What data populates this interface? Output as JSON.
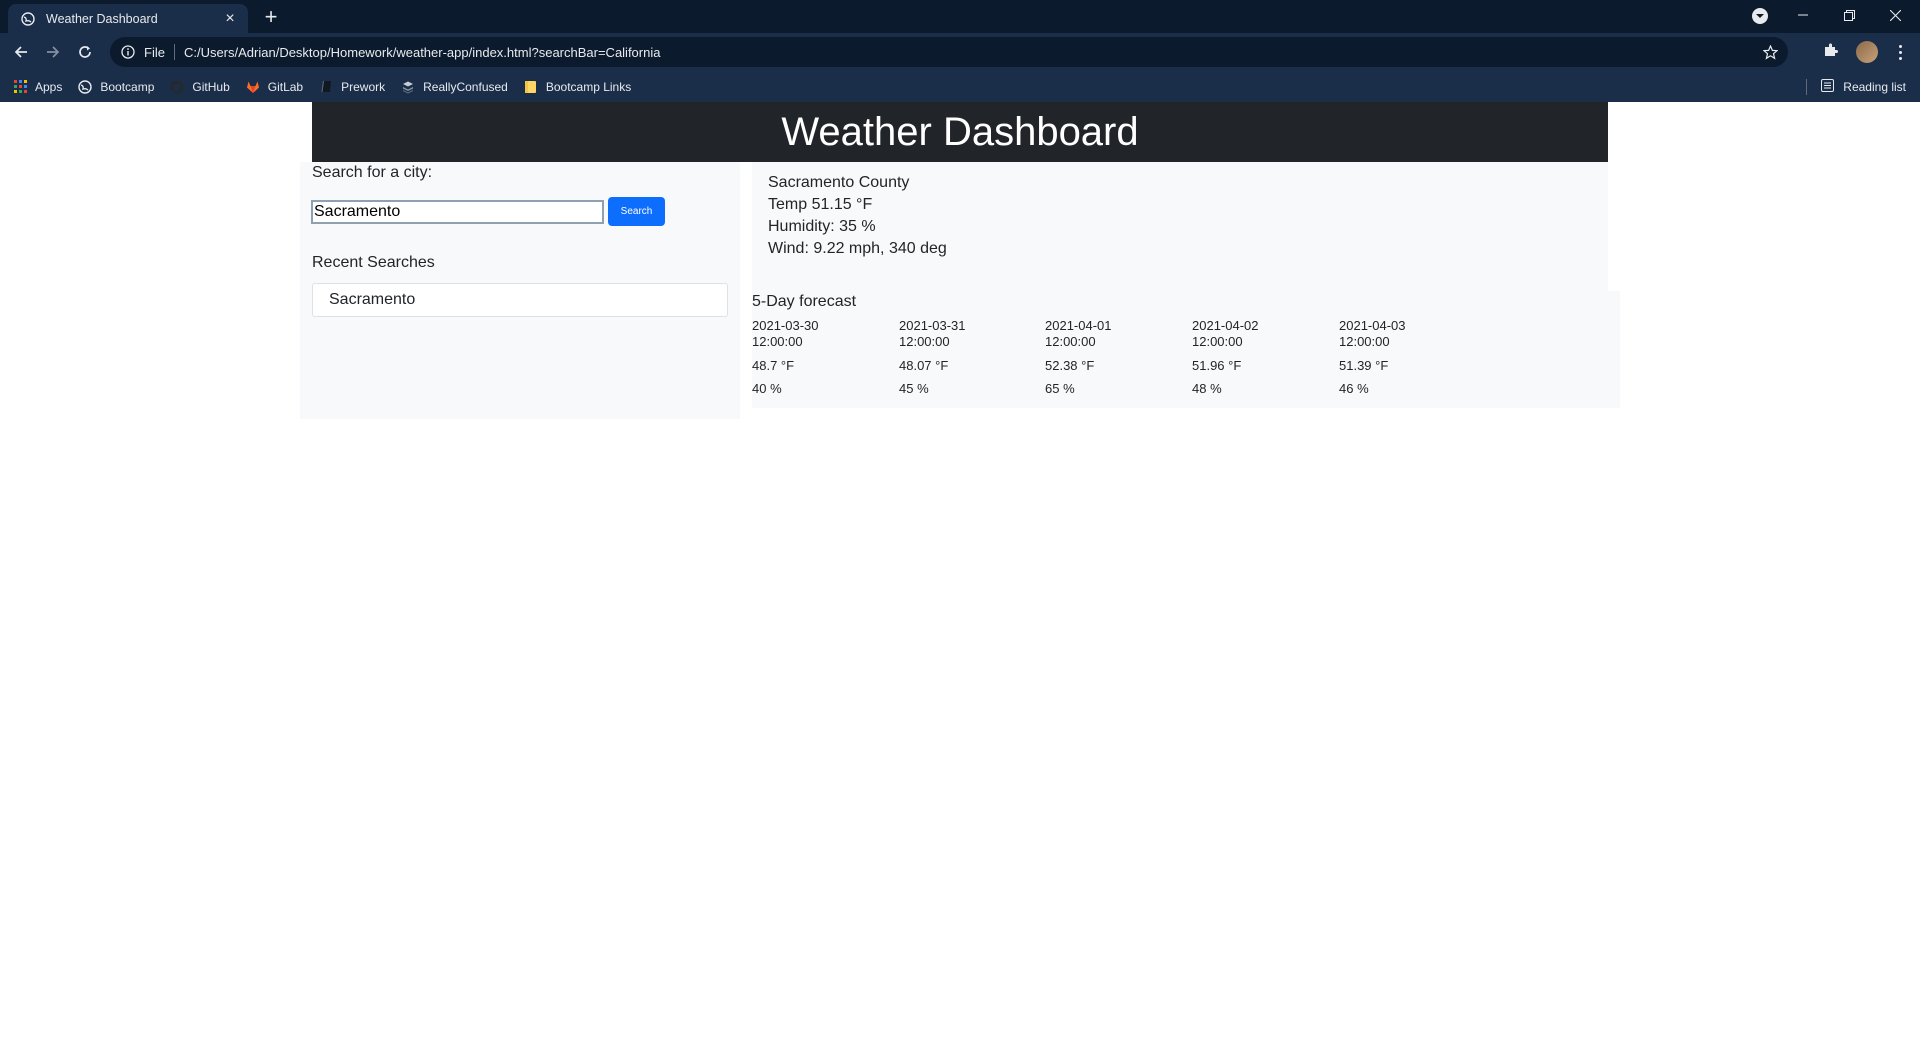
{
  "browser": {
    "tab_title": "Weather Dashboard",
    "address_scheme_label": "File",
    "url": "C:/Users/Adrian/Desktop/Homework/weather-app/index.html?searchBar=California",
    "bookmarks": [
      {
        "label": "Apps",
        "icon": "apps-grid-icon"
      },
      {
        "label": "Bootcamp",
        "icon": "bootcamp-icon"
      },
      {
        "label": "GitHub",
        "icon": "github-icon"
      },
      {
        "label": "GitLab",
        "icon": "gitlab-icon"
      },
      {
        "label": "Prework",
        "icon": "book-icon"
      },
      {
        "label": "ReallyConfused",
        "icon": "stack-icon"
      },
      {
        "label": "Bootcamp Links",
        "icon": "folder-icon"
      }
    ],
    "reading_list_label": "Reading list"
  },
  "header": {
    "title": "Weather Dashboard"
  },
  "search": {
    "label": "Search for a city:",
    "value": "Sacramento",
    "button_label": "Search"
  },
  "recent": {
    "title": "Recent Searches",
    "items": [
      "Sacramento"
    ]
  },
  "current": {
    "location": "Sacramento County",
    "temp": "Temp 51.15 °F",
    "humidity": "Humidity: 35 %",
    "wind": "Wind: 9.22 mph, 340 deg"
  },
  "forecast": {
    "title": "5-Day forecast",
    "days": [
      {
        "date": "2021-03-30 12:00:00",
        "temp": "48.7 °F",
        "humidity": "40 %"
      },
      {
        "date": "2021-03-31 12:00:00",
        "temp": "48.07 °F",
        "humidity": "45 %"
      },
      {
        "date": "2021-04-01 12:00:00",
        "temp": "52.38 °F",
        "humidity": "65 %"
      },
      {
        "date": "2021-04-02 12:00:00",
        "temp": "51.96 °F",
        "humidity": "48 %"
      },
      {
        "date": "2021-04-03 12:00:00",
        "temp": "51.39 °F",
        "humidity": "46 %"
      }
    ]
  },
  "colors": {
    "browser_frame": "#0c1a2e",
    "browser_toolbar": "#1a2e4a",
    "header_bg": "#212529",
    "panel_bg": "#f8f9fa",
    "search_button": "#0d6efd"
  }
}
